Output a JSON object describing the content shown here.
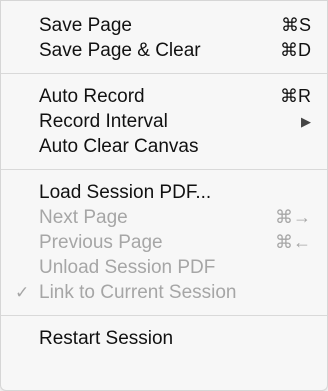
{
  "menu": {
    "groups": [
      [
        {
          "label": "Save Page",
          "shortcut": "⌘S"
        },
        {
          "label": "Save Page & Clear",
          "shortcut": "⌘D"
        }
      ],
      [
        {
          "label": "Auto Record",
          "shortcut": "⌘R"
        },
        {
          "label": "Record Interval",
          "submenu_arrow": "▶"
        },
        {
          "label": "Auto Clear Canvas"
        }
      ],
      [
        {
          "label": "Load Session PDF...",
          "shortcut": ""
        },
        {
          "label": "Next Page",
          "shortcut": "⌘→",
          "disabled": true
        },
        {
          "label": "Previous Page",
          "shortcut": "⌘←",
          "disabled": true
        },
        {
          "label": "Unload Session PDF",
          "disabled": true
        },
        {
          "label": "Link to Current Session",
          "checked": true,
          "checkmark": "✓",
          "disabled": true
        }
      ],
      [
        {
          "label": "Restart Session"
        }
      ]
    ]
  }
}
